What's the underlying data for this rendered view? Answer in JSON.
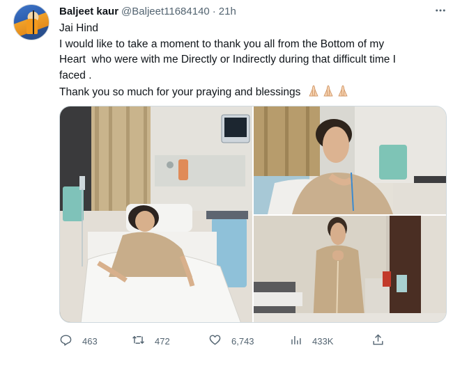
{
  "tweet": {
    "author_name": "Baljeet kaur",
    "handle": "@Baljeet11684140",
    "separator": "·",
    "time": "21h",
    "more_icon": "more-icon",
    "lines": [
      "Jai Hind",
      "I would like to take a moment to thank you all from the Bottom of my",
      "Heart  who were with me Directly or Indirectly during that difficult time I",
      "faced .",
      "Thank you so much for your praying and blessings"
    ],
    "emoji": "🙏🏻🙏🏻🙏🏻"
  },
  "media": {
    "images": [
      {
        "name": "hospital-bed-photo"
      },
      {
        "name": "hand-on-chest-photo"
      },
      {
        "name": "standing-patient-photo"
      }
    ]
  },
  "actions": {
    "reply_count": "463",
    "retweet_count": "472",
    "like_count": "6,743",
    "views_count": "433K",
    "icons": [
      "reply-icon",
      "retweet-icon",
      "like-icon",
      "views-icon",
      "share-icon"
    ]
  }
}
